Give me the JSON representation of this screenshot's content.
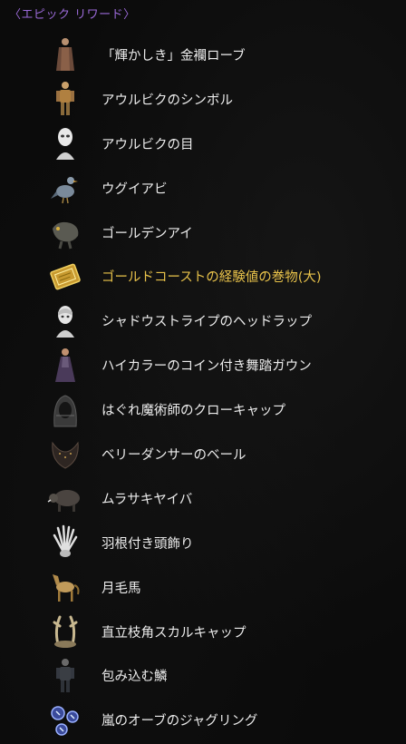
{
  "header": {
    "title": "〈エピック リワード〉"
  },
  "items": [
    {
      "label": "「輝かしき」金襴ローブ",
      "icon": "robe-figure-icon",
      "highlight": false
    },
    {
      "label": "アウルビクのシンボル",
      "icon": "armored-figure-icon",
      "highlight": false
    },
    {
      "label": "アウルビクの目",
      "icon": "white-mask-bust-icon",
      "highlight": false
    },
    {
      "label": "ウグイアビ",
      "icon": "bird-icon",
      "highlight": false
    },
    {
      "label": "ゴールデンアイ",
      "icon": "creature-icon",
      "highlight": false
    },
    {
      "label": "ゴールドコーストの経験値の巻物(大)",
      "icon": "gold-scroll-icon",
      "highlight": true
    },
    {
      "label": "シャドウストライプのヘッドラップ",
      "icon": "headwrap-bust-icon",
      "highlight": false
    },
    {
      "label": "ハイカラーのコイン付き舞踏ガウン",
      "icon": "gown-figure-icon",
      "highlight": false
    },
    {
      "label": "はぐれ魔術師のクローキャップ",
      "icon": "dark-hood-icon",
      "highlight": false
    },
    {
      "label": "ベリーダンサーのベール",
      "icon": "veil-icon",
      "highlight": false
    },
    {
      "label": "ムラサキヤイバ",
      "icon": "boar-mount-icon",
      "highlight": false
    },
    {
      "label": "羽根付き頭飾り",
      "icon": "feather-headdress-icon",
      "highlight": false
    },
    {
      "label": "月毛馬",
      "icon": "horse-icon",
      "highlight": false
    },
    {
      "label": "直立枝角スカルキャップ",
      "icon": "antler-skullcap-icon",
      "highlight": false
    },
    {
      "label": "包み込む鱗",
      "icon": "scale-armor-figure-icon",
      "highlight": false
    },
    {
      "label": "嵐のオーブのジャグリング",
      "icon": "storm-orbs-icon",
      "highlight": false
    }
  ],
  "colors": {
    "header": "#9b6ad8",
    "label": "#ececec",
    "highlight": "#e8c24a",
    "background": "#0b0b0b"
  }
}
